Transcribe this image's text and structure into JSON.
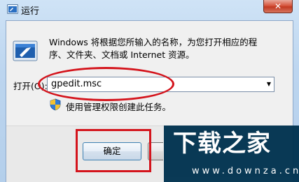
{
  "window": {
    "title": "运行",
    "close_glyph": "✕"
  },
  "dialog": {
    "description": "Windows 将根据您所输入的名称，为您打开相应的程序、文件夹、文档或 Internet 资源。",
    "open_label": "打开(O):",
    "open_value": "gpedit.msc",
    "admin_note": "使用管理权限创建此任务。",
    "ok_label": "确定"
  },
  "watermark": {
    "title": "下载之家",
    "url": "www.downza.cn"
  },
  "colors": {
    "annotation": "#d4141c",
    "watermark_bg": "#00324f"
  },
  "icons": [
    "run-icon",
    "shield-icon",
    "close-icon",
    "dropdown-arrow-icon"
  ]
}
